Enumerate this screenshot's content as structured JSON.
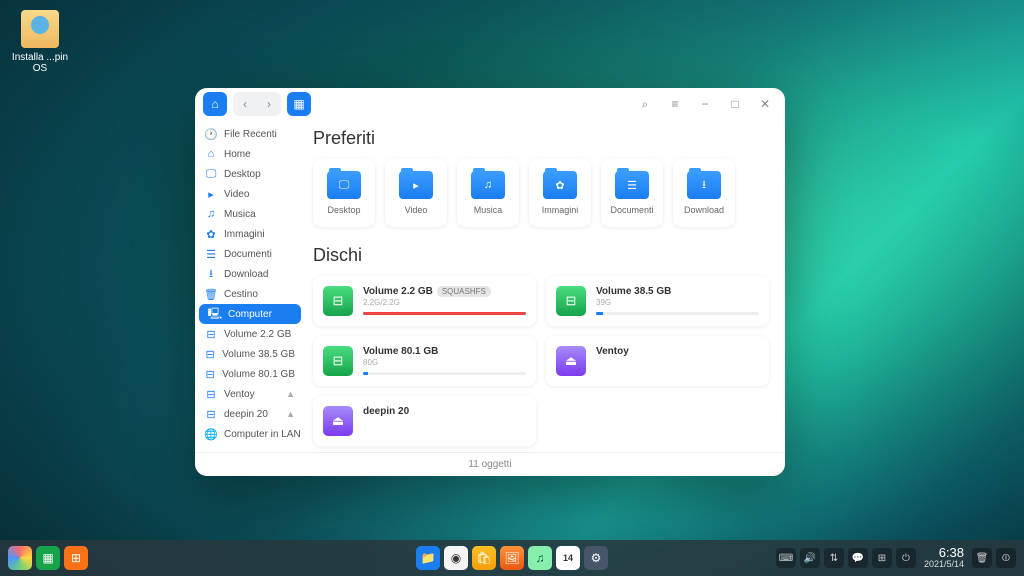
{
  "desktop": {
    "installer_label": "Installa ...pin OS"
  },
  "window": {
    "sidebar": [
      {
        "icon": "🕐",
        "label": "File Recenti"
      },
      {
        "icon": "⌂",
        "label": "Home"
      },
      {
        "icon": "🖵",
        "label": "Desktop"
      },
      {
        "icon": "▸",
        "label": "Video"
      },
      {
        "icon": "♫",
        "label": "Musica"
      },
      {
        "icon": "✿",
        "label": "Immagini"
      },
      {
        "icon": "☰",
        "label": "Documenti"
      },
      {
        "icon": "⭳",
        "label": "Download"
      },
      {
        "icon": "🗑",
        "label": "Cestino"
      },
      {
        "icon": "🖳",
        "label": "Computer",
        "active": true
      },
      {
        "icon": "⊟",
        "label": "Volume 2.2 GB"
      },
      {
        "icon": "⊟",
        "label": "Volume 38.5 GB"
      },
      {
        "icon": "⊟",
        "label": "Volume 80.1 GB"
      },
      {
        "icon": "⊟",
        "label": "Ventoy",
        "eject": true
      },
      {
        "icon": "⊟",
        "label": "deepin 20",
        "eject": true
      },
      {
        "icon": "🌐",
        "label": "Computer in LAN"
      }
    ],
    "section_favorites": "Preferiti",
    "section_disks": "Dischi",
    "favorites": [
      {
        "icon": "🖵",
        "label": "Desktop"
      },
      {
        "icon": "▸",
        "label": "Video"
      },
      {
        "icon": "♫",
        "label": "Musica"
      },
      {
        "icon": "✿",
        "label": "Immagini"
      },
      {
        "icon": "☰",
        "label": "Documenti"
      },
      {
        "icon": "⭳",
        "label": "Download"
      }
    ],
    "disks": [
      {
        "title": "Volume 2.2 GB",
        "badge": "SQUASHFS",
        "sub": "2.2G/2.2G",
        "fill": 100,
        "color": "green",
        "red": true
      },
      {
        "title": "Volume 38.5 GB",
        "sub": "39G",
        "fill": 4,
        "color": "green"
      },
      {
        "title": "Volume 80.1 GB",
        "sub": "80G",
        "fill": 3,
        "color": "green"
      },
      {
        "title": "Ventoy",
        "sub": "",
        "fill": 0,
        "color": "purple"
      },
      {
        "title": "deepin 20",
        "sub": "",
        "fill": 0,
        "color": "purple"
      }
    ],
    "status": "11 oggetti"
  },
  "taskbar": {
    "time": "6:38",
    "date": "2021/5/14",
    "calendar_day": "14"
  }
}
